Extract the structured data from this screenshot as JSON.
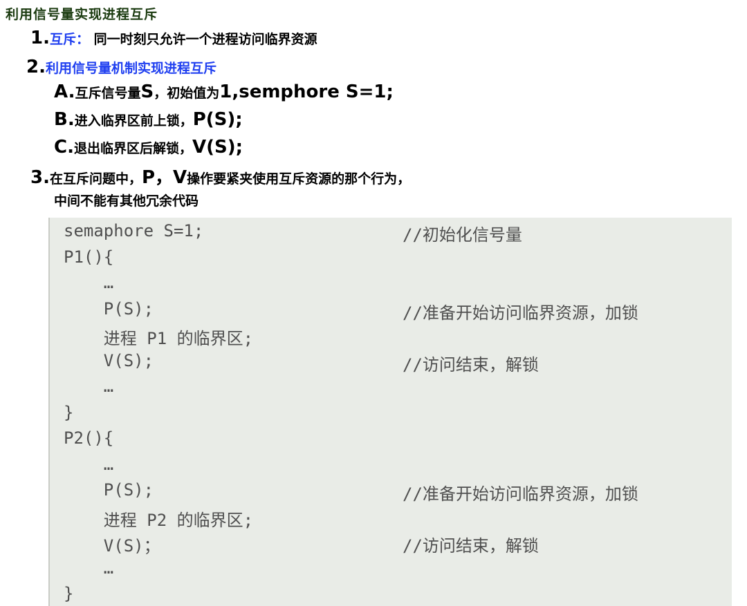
{
  "title": "利用信号量实现进程互斥",
  "item1": {
    "num": "1.",
    "term": "互斥：",
    "text": "同一时刻只允许一个进程访问临界资源"
  },
  "item2": {
    "num": "2.",
    "text": "利用信号量机制实现进程互斥"
  },
  "subA": {
    "letter": "A.",
    "text": "互斥信号量",
    "big1": "S",
    "text2": "，初始值为",
    "big2": "1,semphore S=1;"
  },
  "subB": {
    "letter": "B.",
    "text": "进入临界区前上锁，",
    "big": "P(S);"
  },
  "subC": {
    "letter": "C.",
    "text": "退出临界区后解锁，",
    "big": "V(S);"
  },
  "item3": {
    "num": "3.",
    "text1": "在互斥问题中，",
    "big": "P，V",
    "text2": "操作要紧夹使用互斥资源的那个行为，",
    "line2": "中间不能有其他冗余代码"
  },
  "code": {
    "lines": [
      {
        "code": "semaphore S=1;",
        "comment": "//初始化信号量"
      },
      {
        "code": "P1(){",
        "comment": ""
      },
      {
        "code": "    …",
        "comment": ""
      },
      {
        "code": "    P(S);",
        "comment": "//准备开始访问临界资源，加锁"
      },
      {
        "code": "    进程 P1 的临界区;",
        "comment": ""
      },
      {
        "code": "    V(S);",
        "comment": "//访问结束，解锁"
      },
      {
        "code": "    …",
        "comment": ""
      },
      {
        "code": "}",
        "comment": ""
      },
      {
        "code": "P2(){",
        "comment": ""
      },
      {
        "code": "    …",
        "comment": ""
      },
      {
        "code": "    P(S);",
        "comment": "//准备开始访问临界资源，加锁"
      },
      {
        "code": "    进程 P2 的临界区;",
        "comment": ""
      },
      {
        "code": "    V(S)；",
        "comment": "//访问结束，解锁"
      },
      {
        "code": "    …",
        "comment": ""
      },
      {
        "code": "}",
        "comment": ""
      }
    ]
  }
}
